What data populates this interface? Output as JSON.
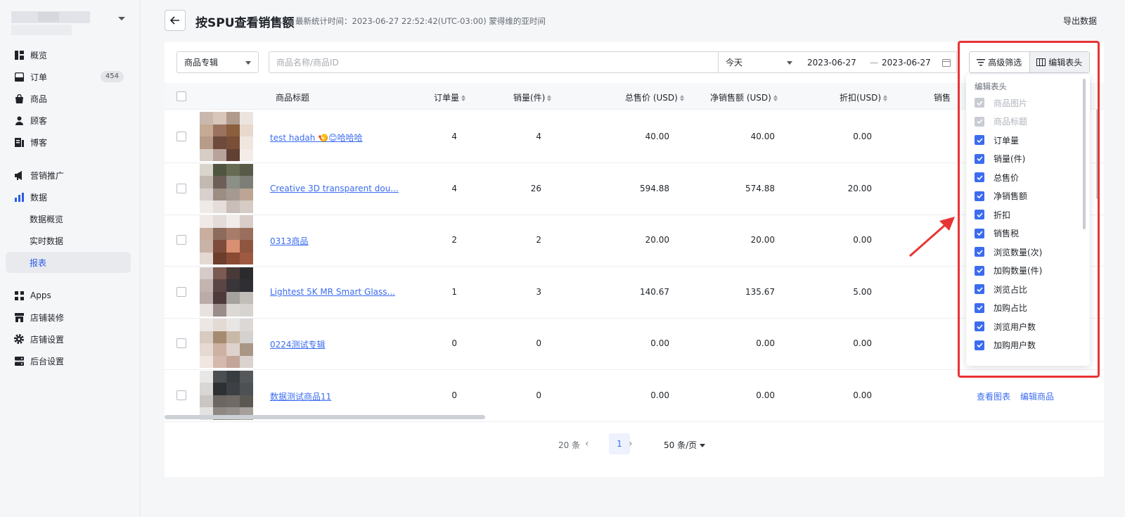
{
  "sidebar": {
    "badge_orders": "454",
    "items": [
      {
        "label": "概览",
        "icon": "overview-icon"
      },
      {
        "label": "订单",
        "icon": "order-box-icon"
      },
      {
        "label": "商品",
        "icon": "goods-bag-icon"
      },
      {
        "label": "顾客",
        "icon": "customer-icon"
      },
      {
        "label": "博客",
        "icon": "blog-icon"
      },
      {
        "label": "营销推广",
        "icon": "megaphone-icon"
      },
      {
        "label": "数据",
        "icon": "bar-chart-icon"
      },
      {
        "label": "数据概览",
        "icon": ""
      },
      {
        "label": "实时数据",
        "icon": ""
      },
      {
        "label": "报表",
        "icon": ""
      },
      {
        "label": "Apps",
        "icon": "apps-grid-icon"
      },
      {
        "label": "店铺装修",
        "icon": "storefront-icon"
      },
      {
        "label": "店铺设置",
        "icon": "gear-icon"
      },
      {
        "label": "后台设置",
        "icon": "server-icon"
      }
    ]
  },
  "header": {
    "title": "按SPU查看销售额",
    "subtitle": "最新统计时间：2023-06-27 22:52:42(UTC-03:00) 蒙得维的亚时间",
    "export_label": "导出数据"
  },
  "filters": {
    "category_select": "商品专辑",
    "search_placeholder": "商品名称/商品ID",
    "date_preset": "今天",
    "date_start": "2023-06-27",
    "date_end": "2023-06-27",
    "date_sep": "—",
    "advanced_filter": "高级筛选",
    "edit_header": "编辑表头"
  },
  "table": {
    "columns": [
      "商品标题",
      "订单量",
      "销量(件)",
      "总售价 (USD)",
      "净销售额 (USD)",
      "折扣(USD)",
      "销售"
    ],
    "rows": [
      {
        "title": "test hadah 🍤😊哈哈哈",
        "orders": "4",
        "qty": "4",
        "total": "40.00",
        "net": "40.00",
        "discount": "0.00",
        "thumb": [
          "#c9b8ae",
          "#d8c6bb",
          "#b09a8c",
          "#ece4df",
          "#c7aa93",
          "#9a7260",
          "#8b5e3c",
          "#e9d8cc",
          "#b79c8a",
          "#6d4a3b",
          "#7a4f37",
          "#efe6e0",
          "#d7cdc7",
          "#b8a39a",
          "#5f4033",
          "#f3ece8"
        ]
      },
      {
        "title": "Creative 3D transparent dou...",
        "orders": "4",
        "qty": "26",
        "total": "594.88",
        "net": "574.88",
        "discount": "20.00",
        "thumb": [
          "#d9d4cc",
          "#4f5540",
          "#676b52",
          "#595b49",
          "#c2b9b2",
          "#6d5f57",
          "#8b8f86",
          "#7c7e77",
          "#d8d0cc",
          "#9c8d83",
          "#a59a92",
          "#bca595",
          "#eeeae7",
          "#e4ddd9",
          "#c8bdb7",
          "#d7ccc5"
        ]
      },
      {
        "title": "0313商品",
        "orders": "2",
        "qty": "2",
        "total": "20.00",
        "net": "20.00",
        "discount": "0.00",
        "thumb": [
          "#efeae8",
          "#e3dcd8",
          "#f1ece9",
          "#d8cdc8",
          "#c9ad9e",
          "#8c6b5c",
          "#a77d6a",
          "#9a6e5c",
          "#c9b2a8",
          "#7d4c3c",
          "#d98f72",
          "#8e553f",
          "#e3d8d2",
          "#6e3e2d",
          "#8a4b34",
          "#9e5a41"
        ]
      },
      {
        "title": "Lightest 5K MR Smart Glass...",
        "orders": "1",
        "qty": "3",
        "total": "140.67",
        "net": "135.67",
        "discount": "5.00",
        "thumb": [
          "#d5ccc9",
          "#7b5a52",
          "#4a3a37",
          "#2b2a2d",
          "#c3b4b0",
          "#5b4444",
          "#39363a",
          "#2f2f33",
          "#b9aca9",
          "#4f3a3b",
          "#a6a39f",
          "#c1beba",
          "#e7e2e0",
          "#9a8c89",
          "#dcd9d5",
          "#d6d3d0"
        ]
      },
      {
        "title": "0224测试专辑",
        "orders": "0",
        "qty": "0",
        "total": "0.00",
        "net": "0.00",
        "discount": "0.00",
        "thumb": [
          "#ece7e4",
          "#e3dad4",
          "#e8e6e4",
          "#dcd8d6",
          "#d7cbc2",
          "#a58b70",
          "#c9b9a6",
          "#d5d1ce",
          "#e6d9d2",
          "#cdb1a2",
          "#ded2cc",
          "#a99684",
          "#f0e6e2",
          "#d5b9ad",
          "#c4a699",
          "#d9d2ce"
        ]
      },
      {
        "title": "数据测试商品11",
        "orders": "0",
        "qty": "0",
        "total": "0.00",
        "net": "0.00",
        "discount": "0.00",
        "actions": [
          "查看图表",
          "编辑商品"
        ],
        "thumb": [
          "#e8e7e6",
          "#4b4f53",
          "#3a3d40",
          "#55585b",
          "#d9d7d5",
          "#2e3133",
          "#3d4044",
          "#4e5154",
          "#c9c6c3",
          "#6b6661",
          "#6f6a66",
          "#5b5753",
          "#e4e2e0",
          "#8d8884",
          "#948f8b",
          "#a5a09b"
        ]
      }
    ]
  },
  "pagination": {
    "total": "20 条",
    "current": "1",
    "page_size": "50 条/页"
  },
  "popover": {
    "title": "编辑表头",
    "items": [
      {
        "label": "商品图片",
        "disabled": true
      },
      {
        "label": "商品标题",
        "disabled": true
      },
      {
        "label": "订单量",
        "disabled": false
      },
      {
        "label": "销量(件)",
        "disabled": false
      },
      {
        "label": "总售价",
        "disabled": false
      },
      {
        "label": "净销售额",
        "disabled": false
      },
      {
        "label": "折扣",
        "disabled": false
      },
      {
        "label": "销售税",
        "disabled": false
      },
      {
        "label": "浏览数量(次)",
        "disabled": false
      },
      {
        "label": "加购数量(件)",
        "disabled": false
      },
      {
        "label": "浏览占比",
        "disabled": false
      },
      {
        "label": "加购占比",
        "disabled": false
      },
      {
        "label": "浏览用户数",
        "disabled": false
      },
      {
        "label": "加购用户数",
        "disabled": false
      }
    ]
  },
  "colors": {
    "accent": "#3b6cf0",
    "highlight": "#e83434"
  }
}
